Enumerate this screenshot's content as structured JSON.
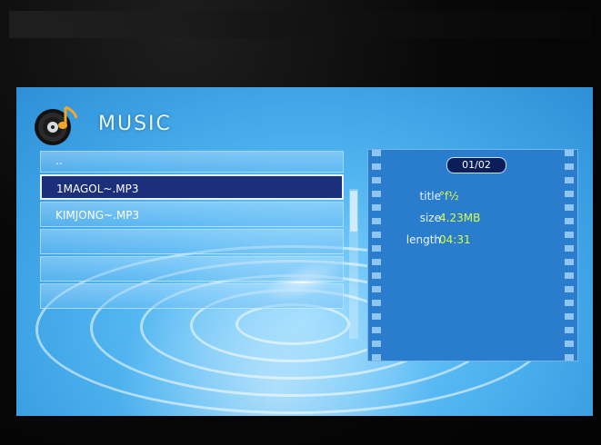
{
  "app": {
    "title": "MUSIC"
  },
  "file_list": {
    "items": [
      {
        "label": "..",
        "selected": false
      },
      {
        "label": "1MAGOL~.MP3",
        "selected": true
      },
      {
        "label": "KIMJONG~.MP3",
        "selected": false
      },
      {
        "label": "",
        "selected": false
      },
      {
        "label": "",
        "selected": false
      },
      {
        "label": "",
        "selected": false
      }
    ]
  },
  "info_panel": {
    "counter": "01/02",
    "fields": [
      {
        "key": "title",
        "value": "°f½"
      },
      {
        "key": "size",
        "value": "4.23MB"
      },
      {
        "key": "length",
        "value": "04:31"
      }
    ]
  },
  "icons": {
    "header": "music-disc-note-icon"
  },
  "colors": {
    "screen_blue": "#55b8f2",
    "selection_navy": "#1c2f7a",
    "info_value_yellow": "#d8ff4a",
    "info_panel_blue": "#2a7ccc"
  }
}
